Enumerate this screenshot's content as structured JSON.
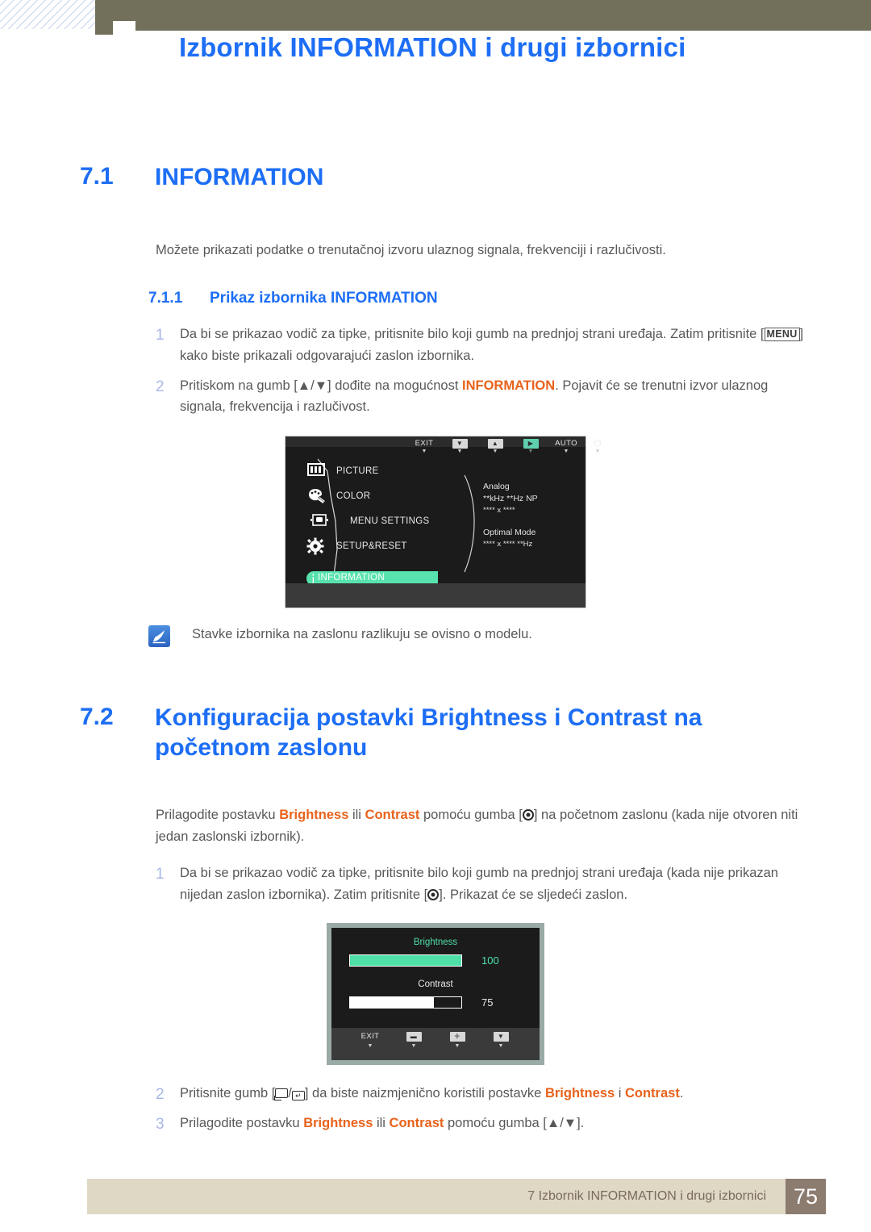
{
  "header": {
    "title": "Izbornik INFORMATION i drugi izbornici"
  },
  "sections": {
    "s71": {
      "number": "7.1",
      "title": "INFORMATION",
      "intro": "Možete prikazati podatke o trenutačnoj izvoru ulaznog signala, frekvenciji i razlučivosti.",
      "sub": {
        "number": "7.1.1",
        "title": "Prikaz izbornika INFORMATION"
      },
      "steps": [
        {
          "num": "1",
          "part1": "Da bi se prikazao vodič za tipke, pritisnite bilo koji gumb na prednjoj strani uređaja. Zatim pritisnite [",
          "key": "MENU",
          "part2": "] kako biste prikazali odgovarajući zaslon izbornika."
        },
        {
          "num": "2",
          "part1": "Pritiskom na gumb [▲/▼] dođite na mogućnost ",
          "highlight": "INFORMATION",
          "part2": ". Pojavit će se trenutni izvor ulaznog signala, frekvencija i razlučivost."
        }
      ],
      "note": {
        "icon": "note-pen-icon",
        "text": "Stavke izbornika na zaslonu razlikuju se ovisno o modelu."
      }
    },
    "s72": {
      "number": "7.2",
      "title_line1": "Konfiguracija postavki Brightness i Contrast na",
      "title_line2": "početnom zaslonu",
      "intro": {
        "part1": "Prilagodite postavku ",
        "hl1": "Brightness",
        "part2": " ili ",
        "hl2": "Contrast",
        "part3": " pomoću gumba [",
        "part4": "] na početnom zaslonu (kada nije otvoren niti jedan zaslonski izbornik)."
      },
      "steps": [
        {
          "num": "1",
          "part1": "Da bi se prikazao vodič za tipke, pritisnite bilo koji gumb na prednjoj strani uređaja (kada nije prikazan nijedan zaslon izbornika). Zatim pritisnite [",
          "part2": "]. Prikazat će se sljedeći zaslon."
        },
        {
          "num": "2",
          "part1": "Pritisnite gumb [",
          "sep": "/",
          "part2": "] da biste naizmjenično koristili postavke ",
          "hl1": "Brightness",
          "part3": " i ",
          "hl2": "Contrast",
          "part4": "."
        },
        {
          "num": "3",
          "part1": "Prilagodite postavku ",
          "hl1": "Brightness",
          "part2": " ili ",
          "hl2": "Contrast",
          "part3": " pomoću gumba [▲/▼]."
        }
      ]
    }
  },
  "osd_information": {
    "menu_items": [
      {
        "icon": "picture-icon",
        "label": "PICTURE"
      },
      {
        "icon": "color-palette-icon",
        "label": "COLOR"
      },
      {
        "icon": "menu-settings-icon",
        "label": "MENU SETTINGS"
      },
      {
        "icon": "gear-icon",
        "label": "SETUP&RESET"
      }
    ],
    "selected_item": {
      "icon": "info-icon",
      "label": "INFORMATION"
    },
    "info_panel": {
      "line1": "Analog",
      "line2": "**kHz **Hz NP",
      "line3": "**** x ****",
      "line4": "Optimal Mode",
      "line5": "**** x ****  **Hz"
    },
    "bottom_bar": [
      {
        "label": "EXIT",
        "type": "text"
      },
      {
        "label": "▼",
        "type": "box"
      },
      {
        "label": "▲",
        "type": "box"
      },
      {
        "label": "▶",
        "type": "box-teal"
      },
      {
        "label": "AUTO",
        "type": "text"
      },
      {
        "label": "⏻",
        "type": "power"
      }
    ],
    "colors": {
      "highlight": "#58e3ae",
      "background": "#1b1b1b",
      "bottom_bar": "#3a3a3a"
    }
  },
  "osd_brightness_contrast": {
    "brightness": {
      "label": "Brightness",
      "value": "100",
      "fill_percent": 100,
      "color": "#4fe0a8"
    },
    "contrast": {
      "label": "Contrast",
      "value": "75",
      "fill_percent": 75,
      "color": "#ffffff"
    },
    "bottom_bar": [
      {
        "label": "EXIT",
        "type": "text"
      },
      {
        "label": "▬",
        "type": "box"
      },
      {
        "label": "✛",
        "type": "box"
      },
      {
        "label": "▼",
        "type": "box"
      }
    ]
  },
  "footer": {
    "text": "7 Izbornik INFORMATION i drugi izbornici",
    "page": "75"
  },
  "colors": {
    "heading_blue": "#1d6ef5",
    "accent_orange": "#e8621b",
    "body_gray": "#58585a",
    "olive": "#726f5a",
    "footer_bar": "#ded8c4",
    "footer_page": "#8c7b6f",
    "step_number": "#a9b7e8"
  }
}
